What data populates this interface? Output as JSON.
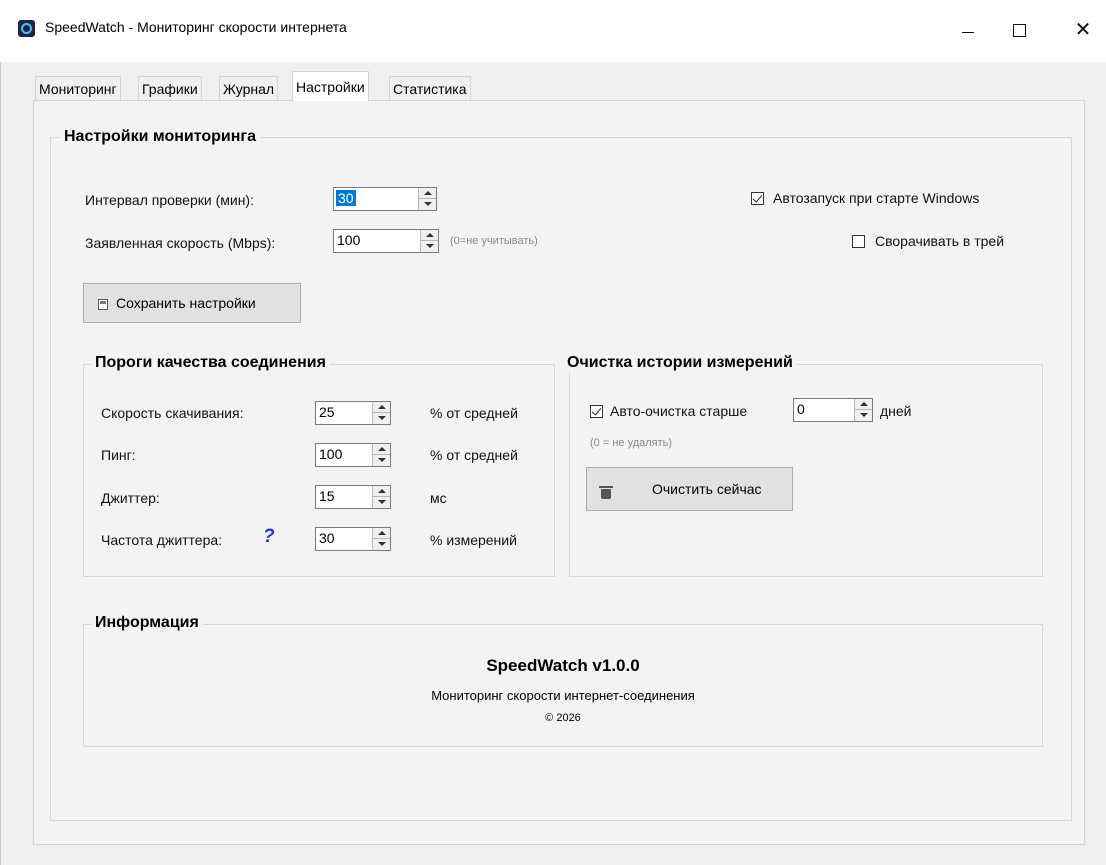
{
  "window": {
    "title": "SpeedWatch - Мониторинг скорости интернета",
    "minimize": "—",
    "maximize": "☐",
    "close": "✕"
  },
  "tabs": [
    {
      "label": "Мониторинг"
    },
    {
      "label": "Графики"
    },
    {
      "label": "Журнал"
    },
    {
      "label": "Настройки",
      "active": true
    },
    {
      "label": "Статистика"
    }
  ],
  "monitoring": {
    "group_title": "Настройки мониторинга",
    "interval_label": "Интервал проверки (мин):",
    "interval_value": "30",
    "speed_label": "Заявленная скорость (Mbps):",
    "speed_value": "100",
    "speed_hint": "(0=не учитывать)",
    "autostart_label": "Автозапуск при старте Windows",
    "autostart_checked": true,
    "tray_label": "Сворачивать в трей",
    "tray_checked": false,
    "save_label": "Сохранить настройки"
  },
  "thresholds": {
    "group_title": "Пороги качества соединения",
    "rows": [
      {
        "label": "Скорость скачивания:",
        "value": "25",
        "unit": "% от средней"
      },
      {
        "label": "Пинг:",
        "value": "100",
        "unit": "% от средней"
      },
      {
        "label": "Джиттер:",
        "value": "15",
        "unit": "мс"
      },
      {
        "label": "Частота джиттера:",
        "value": "30",
        "unit": "% измерений"
      }
    ]
  },
  "cleanup": {
    "group_title": "Очистка истории измерений",
    "auto_label": "Авто-очистка старше",
    "auto_checked": true,
    "days_value": "0",
    "days_unit": "дней",
    "hint": "(0 = не удалять)",
    "clear_label": "Очистить сейчас"
  },
  "info": {
    "group_title": "Информация",
    "app_name": "SpeedWatch v1.0.0",
    "description": "Мониторинг скорости интернет-соединения",
    "copyright": "© 2026"
  },
  "colors": {
    "accent": "#0078d7",
    "help_icon": "#1d3fd6",
    "panel": "#f3f3f3"
  }
}
